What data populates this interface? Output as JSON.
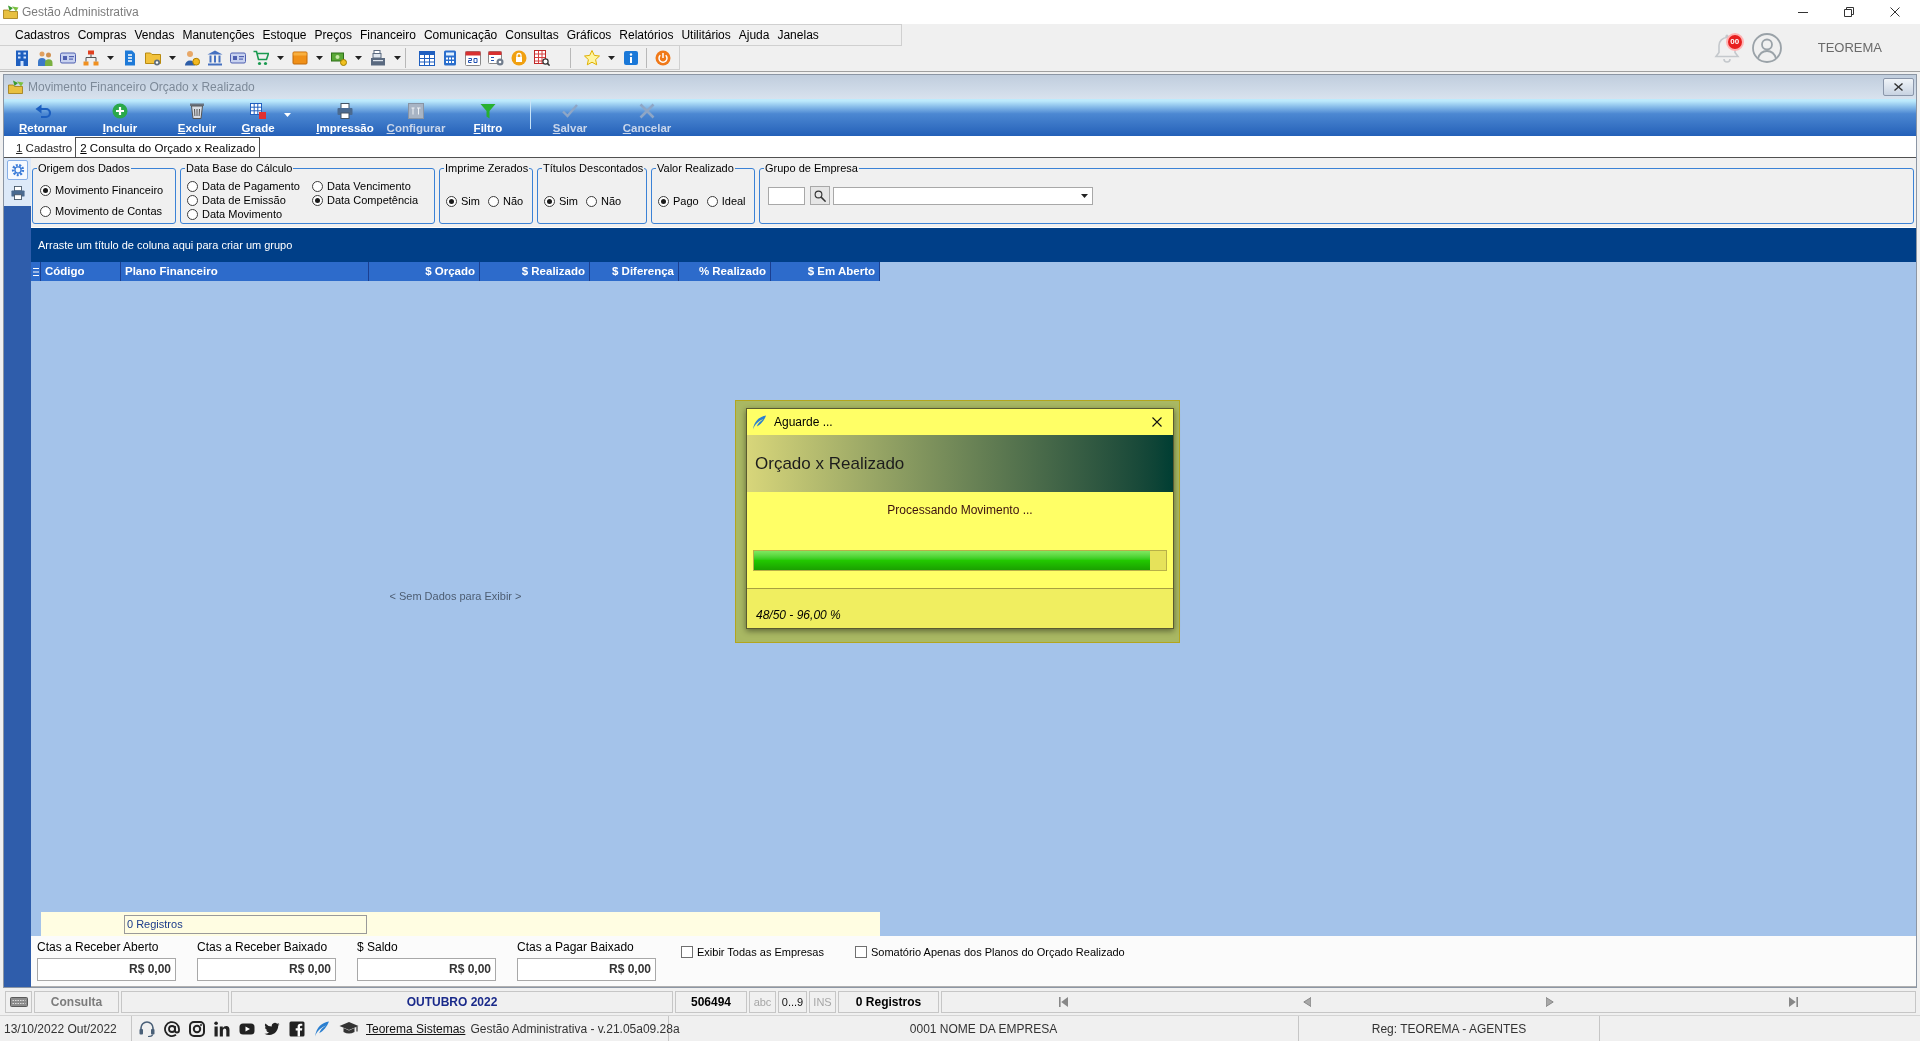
{
  "window": {
    "title": "Gestão Administrativa"
  },
  "menu": [
    "Cadastros",
    "Compras",
    "Vendas",
    "Manutenções",
    "Estoque",
    "Preços",
    "Financeiro",
    "Comunicação",
    "Consultas",
    "Gráficos",
    "Relatórios",
    "Utilitários",
    "Ajuda",
    "Janelas"
  ],
  "header": {
    "badge": "00",
    "user": "TEOREMA"
  },
  "child_window": {
    "title": "Movimento Financeiro Orçado x Realizado",
    "toolbar": [
      {
        "label": "Retornar",
        "disabled": false
      },
      {
        "label": "Incluir",
        "disabled": false
      },
      {
        "label": "Excluir",
        "disabled": false
      },
      {
        "label": "Grade",
        "disabled": false
      },
      {
        "label": "Impressão",
        "disabled": false
      },
      {
        "label": "Configurar",
        "disabled": true
      },
      {
        "label": "Filtro",
        "disabled": false
      },
      {
        "label": "Salvar",
        "disabled": true
      },
      {
        "label": "Cancelar",
        "disabled": true
      }
    ],
    "tabs": [
      {
        "label": "1 Cadastro",
        "selected": false
      },
      {
        "label": "2 Consulta do Orçado x Realizado",
        "selected": true
      }
    ],
    "side_tools": [
      {
        "selected": true
      },
      {
        "selected": false
      }
    ],
    "filters": [
      {
        "title": "Origem dos Dados",
        "kind": "stack",
        "options": [
          {
            "label": "Movimento Financeiro",
            "selected": true
          },
          {
            "label": "Movimento de Contas",
            "selected": false
          }
        ]
      },
      {
        "title": "Data Base do Cálculo",
        "kind": "grid",
        "options": [
          {
            "label": "Data de Pagamento",
            "selected": false
          },
          {
            "label": "Data Vencimento",
            "selected": false
          },
          {
            "label": "Data de Emissão",
            "selected": false
          },
          {
            "label": "Data Competência",
            "selected": true
          },
          {
            "label": "Data Movimento",
            "selected": false
          }
        ]
      },
      {
        "title": "Imprime Zerados",
        "kind": "row",
        "options": [
          {
            "label": "Sim",
            "selected": true
          },
          {
            "label": "Não",
            "selected": false
          }
        ]
      },
      {
        "title": "Títulos Descontados",
        "kind": "row",
        "options": [
          {
            "label": "Sim",
            "selected": true
          },
          {
            "label": "Não",
            "selected": false
          }
        ]
      },
      {
        "title": "Valor Realizado",
        "kind": "row",
        "options": [
          {
            "label": "Pago",
            "selected": true
          },
          {
            "label": "Ideal",
            "selected": false
          }
        ]
      }
    ],
    "company_group": {
      "title": "Grupo de Empresa"
    },
    "grid": {
      "group_hint": "Arraste um título de coluna aqui para criar um grupo",
      "columns": [
        {
          "label": "Código",
          "kind": "text"
        },
        {
          "label": "Plano Financeiro",
          "kind": "text"
        },
        {
          "label": "$ Orçado",
          "kind": "number"
        },
        {
          "label": "$ Realizado",
          "kind": "number"
        },
        {
          "label": "$ Diferença",
          "kind": "number"
        },
        {
          "label": "% Realizado",
          "kind": "number"
        },
        {
          "label": "$ Em Aberto",
          "kind": "number"
        }
      ],
      "empty_text": "< Sem Dados para Exibir >",
      "footer": "0 Registros"
    },
    "totals": [
      {
        "label": "Ctas a Receber Aberto",
        "value": "R$ 0,00"
      },
      {
        "label": "Ctas a Receber Baixado",
        "value": "R$ 0,00"
      },
      {
        "label": "$ Saldo",
        "value": "R$ 0,00"
      },
      {
        "label": "Ctas a Pagar Baixado",
        "value": "R$ 0,00"
      }
    ],
    "options": [
      {
        "label": "Exibir Todas as Empresas",
        "checked": false
      },
      {
        "label": "Somatório Apenas dos Planos do Orçado Realizado",
        "checked": false
      }
    ]
  },
  "dialog": {
    "title": "Aguarde ...",
    "heading": "Orçado x Realizado",
    "message": "Processando Movimento ...",
    "progress": {
      "level": 0.96
    },
    "footer": "48/50 - 96,00 %"
  },
  "status_bar": {
    "mode": "Consulta",
    "period": "OUTUBRO 2022",
    "code": "506494",
    "indicators": [
      {
        "label": "abc",
        "on": false
      },
      {
        "label": "0...9",
        "on": true
      },
      {
        "label": "INS",
        "on": false
      }
    ],
    "records": "0 Registros"
  },
  "footer_bar": {
    "date": "13/10/2022 Out/2022",
    "link": "Teorema Sistemas",
    "version": "Gestão Administrativa - v.21.05a09.28a",
    "company": "0001 NOME DA EMPRESA",
    "registration": "Reg: TEOREMA - AGENTES"
  }
}
